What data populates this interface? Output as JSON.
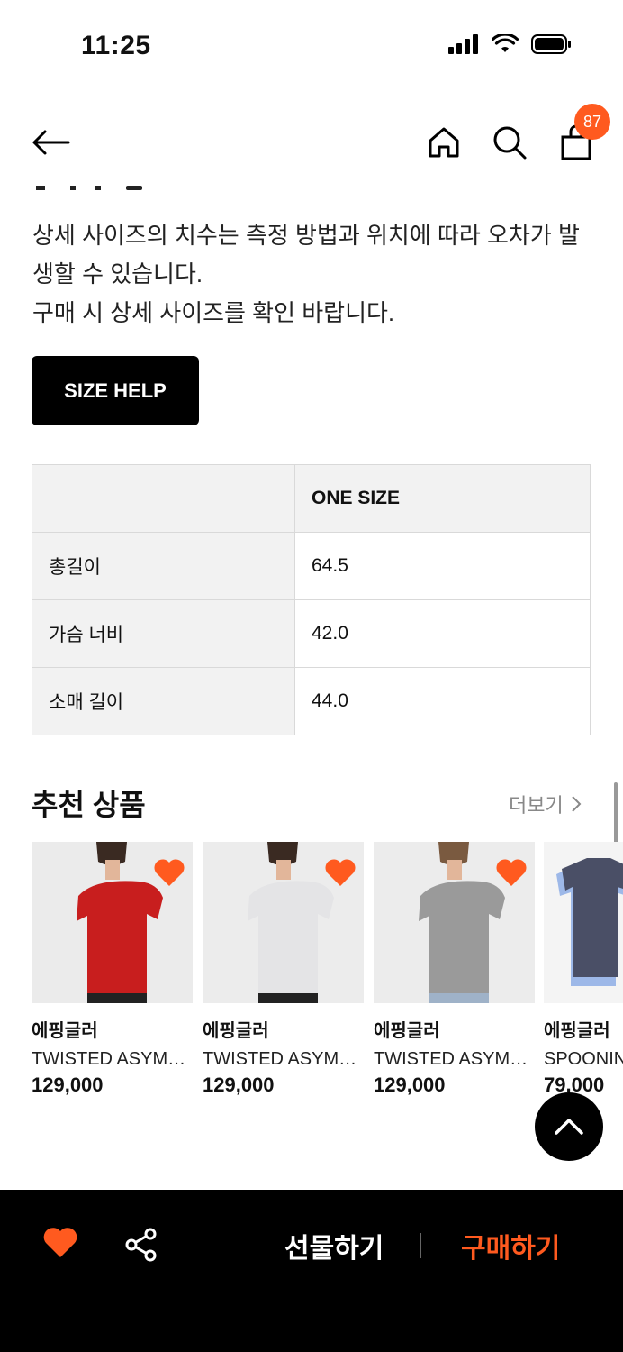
{
  "status": {
    "time": "11:25"
  },
  "header": {
    "cart_count": "87"
  },
  "notice": {
    "line1": "상세 사이즈의 치수는 측정 방법과 위치에 따라 오차가 발생할 수 있습니다.",
    "line2": "구매 시 상세 사이즈를 확인 바랍니다."
  },
  "size_help_label": "SIZE HELP",
  "size_table": {
    "header": "ONE SIZE",
    "rows": [
      {
        "label": "총길이",
        "value": "64.5"
      },
      {
        "label": "가슴 너비",
        "value": "42.0"
      },
      {
        "label": "소매 길이",
        "value": "44.0"
      }
    ]
  },
  "recommend": {
    "title": "추천 상품",
    "more": "더보기",
    "items": [
      {
        "brand": "에핑글러",
        "name": "TWISTED ASYMMETRIC TOP",
        "price": "129,000",
        "color": "#c81e1e"
      },
      {
        "brand": "에핑글러",
        "name": "TWISTED ASYMMETRIC TOP",
        "price": "129,000",
        "color": "#e4e4e6"
      },
      {
        "brand": "에핑글러",
        "name": "TWISTED ASYMMETRIC TOP",
        "price": "129,000",
        "color": "#9a9a9a"
      },
      {
        "brand": "에핑글러",
        "name": "SPOONING",
        "price": "79,000",
        "color": "#4a4f66"
      }
    ]
  },
  "bottom_bar": {
    "gift": "선물하기",
    "buy": "구매하기"
  },
  "colors": {
    "accent": "#ff5a1f",
    "black": "#000000"
  }
}
